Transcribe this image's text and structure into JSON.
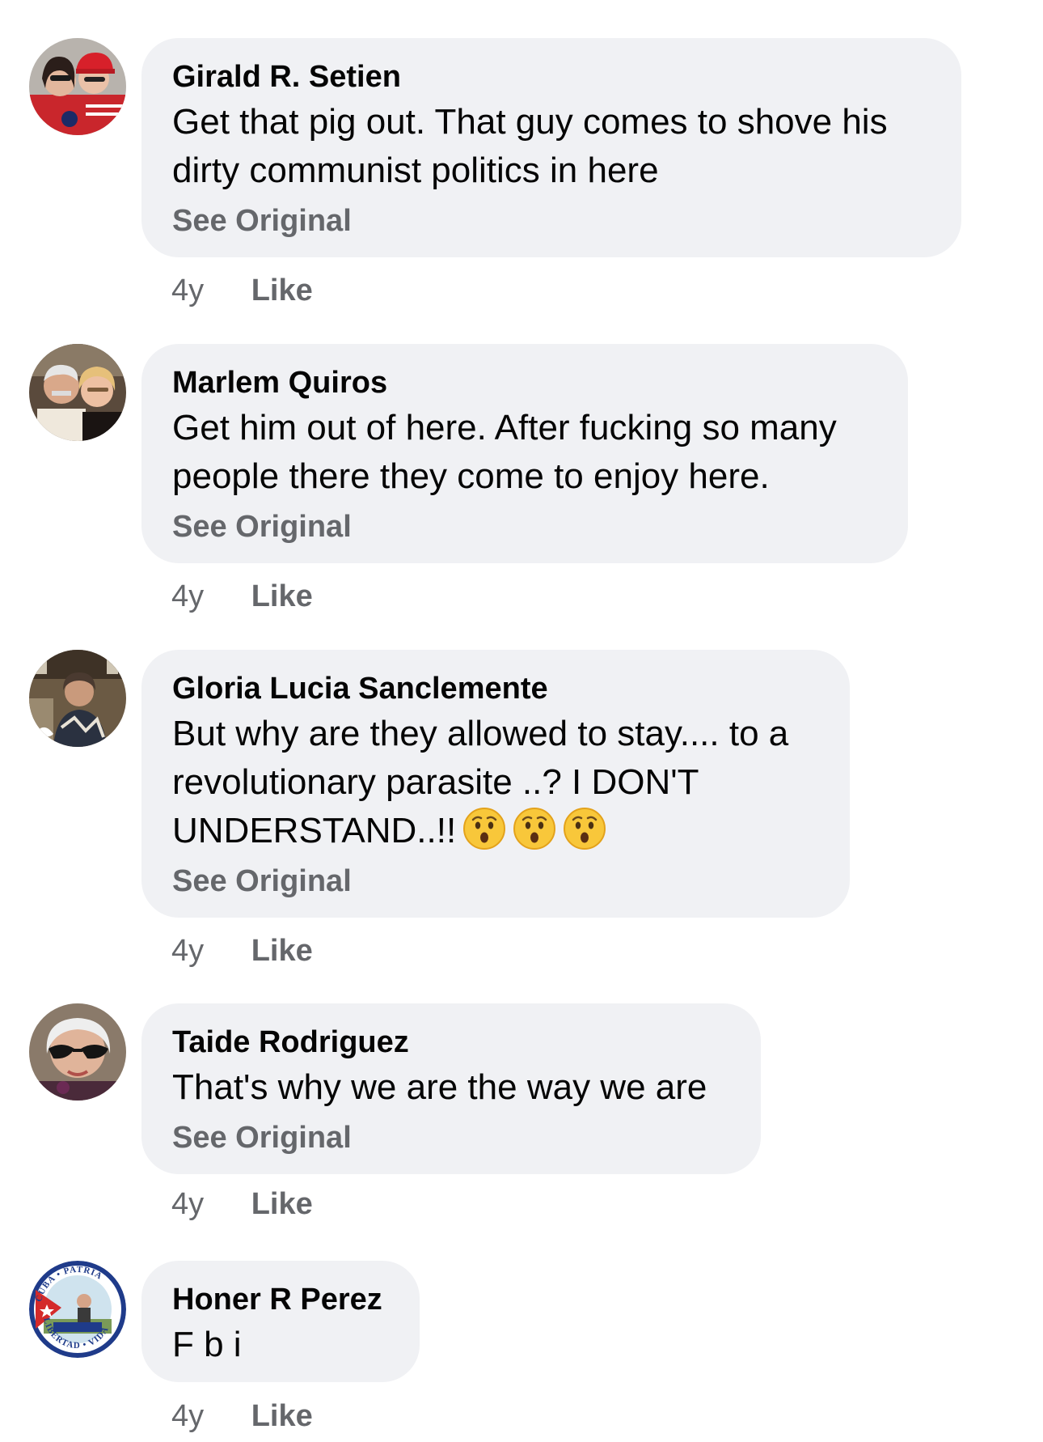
{
  "comments": [
    {
      "author": "Girald R. Setien",
      "lines": [
        "Get that pig out. That guy comes to shove his",
        "dirty communist politics in here"
      ],
      "see_original": "See Original",
      "time": "4y",
      "like": "Like"
    },
    {
      "author": "Marlem Quiros",
      "lines": [
        "Get him out of here. After fucking so many",
        "people there they come to enjoy here."
      ],
      "see_original": "See Original",
      "time": "4y",
      "like": "Like"
    },
    {
      "author": "Gloria Lucia Sanclemente",
      "lines": [
        "But why are they allowed to stay.... to a",
        "revolutionary parasite ..? I DON'T",
        "UNDERSTAND..!!"
      ],
      "emoji": "hushed-face-emoji",
      "see_original": "See Original",
      "time": "4y",
      "like": "Like"
    },
    {
      "author": "Taide Rodriguez",
      "lines": [
        "That's why we are the way we are"
      ],
      "see_original": "See Original",
      "time": "4y",
      "like": "Like"
    },
    {
      "author": "Honer R Perez",
      "lines": [
        "F b i"
      ],
      "time": "4y",
      "like": "Like"
    }
  ],
  "avatars": {
    "honer_badge_text_top": "CUBA • PATRIA",
    "honer_badge_text_bottom": "LIBERTAD • VIDA"
  },
  "colors": {
    "bubble_bg": "#f0f1f4",
    "secondary_text": "#65676b",
    "primary_text": "#050505"
  }
}
